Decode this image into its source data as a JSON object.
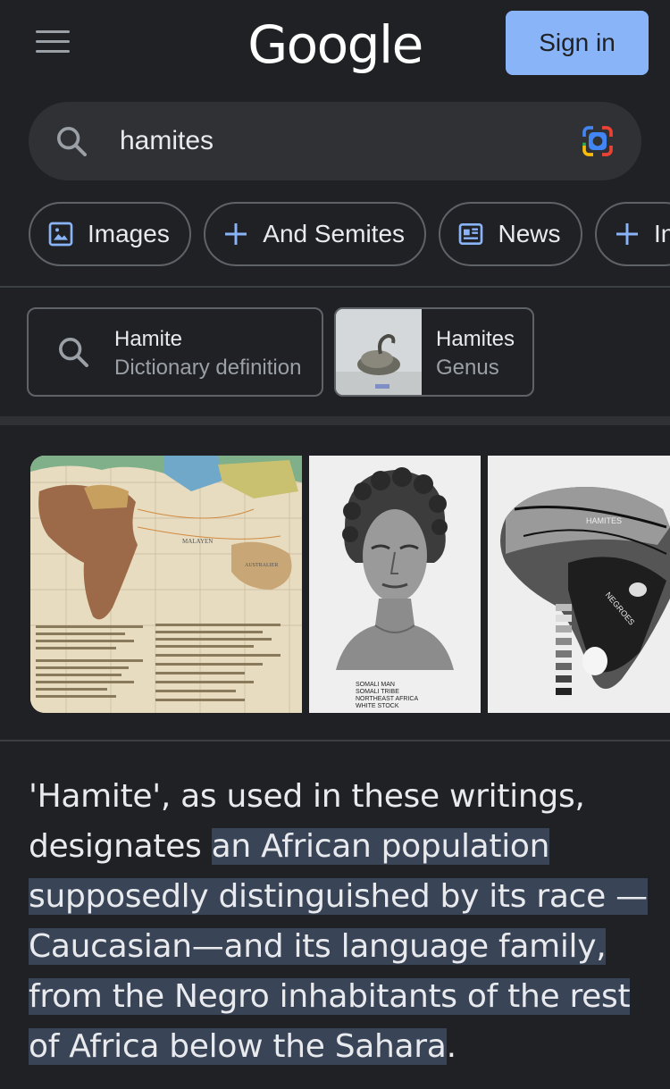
{
  "header": {
    "logo": "Google",
    "signin_label": "Sign in"
  },
  "search": {
    "query": "hamites"
  },
  "chips": [
    {
      "icon": "image-icon",
      "label": "Images"
    },
    {
      "icon": "plus-icon",
      "label": "And Semites"
    },
    {
      "icon": "news-icon",
      "label": "News"
    },
    {
      "icon": "plus-icon",
      "label": "In"
    }
  ],
  "entity_cards": [
    {
      "title": "Hamite",
      "subtitle": "Dictionary definition",
      "icon": "search-icon"
    },
    {
      "title": "Hamites",
      "subtitle": "Genus",
      "icon": "thumbnail"
    }
  ],
  "images": [
    {
      "name": "africa-race-map",
      "labels": [
        "MALAYEN",
        "AUSTRALIER"
      ]
    },
    {
      "name": "somali-man-bust",
      "caption": [
        "SOMALI MAN",
        "SOMALI TRIBE",
        "NORTHEAST AFRICA",
        "WHITE STOCK"
      ]
    },
    {
      "name": "africa-hamites-map",
      "labels": [
        "HAMITES",
        "NEGROES"
      ]
    }
  ],
  "snippet": {
    "before": "'Hamite', as used in these writings, designates ",
    "highlight": "an African population supposedly distinguished by its race — Caucasian—and its language family, from the Negro inhabitants of the rest of Africa below the Sahara",
    "after": "."
  },
  "colors": {
    "background": "#202124",
    "accent": "#8ab4f8",
    "highlight": "#394457"
  }
}
